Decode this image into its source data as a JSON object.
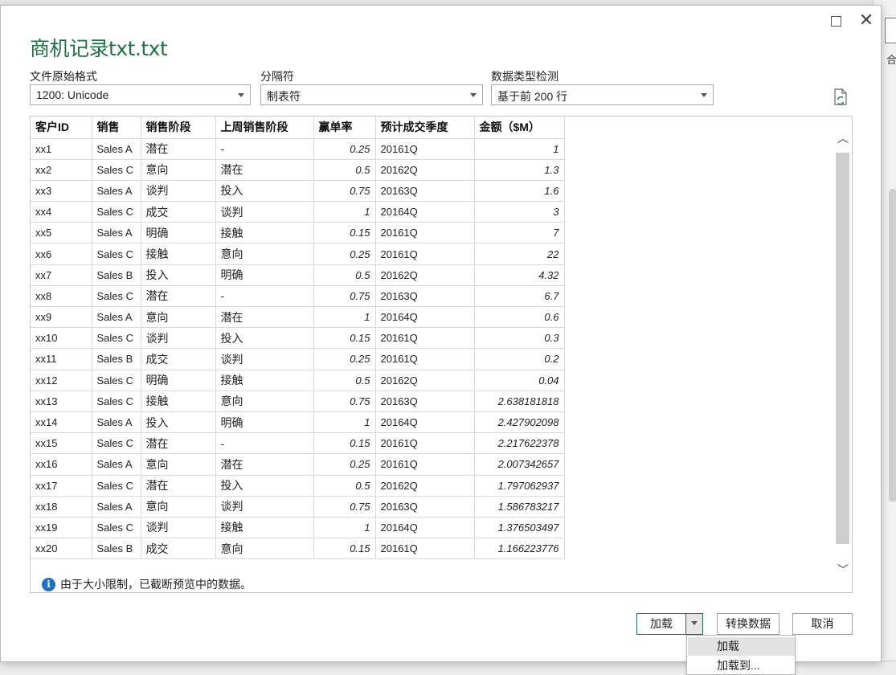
{
  "dialog": {
    "title": "商机记录txt.txt",
    "file_origin": {
      "label": "文件原始格式",
      "value": "1200: Unicode"
    },
    "delimiter": {
      "label": "分隔符",
      "value": "制表符"
    },
    "type_detection": {
      "label": "数据类型检测",
      "value": "基于前 200 行"
    }
  },
  "table": {
    "headers": [
      "客户ID",
      "销售",
      "销售阶段",
      "上周销售阶段",
      "赢单率",
      "预计成交季度",
      "金额（$M）"
    ],
    "rows": [
      [
        "xx1",
        "Sales A",
        "潜在",
        "-",
        "0.25",
        "20161Q",
        "1"
      ],
      [
        "xx2",
        "Sales C",
        "意向",
        "潜在",
        "0.5",
        "20162Q",
        "1.3"
      ],
      [
        "xx3",
        "Sales A",
        "谈判",
        "投入",
        "0.75",
        "20163Q",
        "1.6"
      ],
      [
        "xx4",
        "Sales C",
        "成交",
        "谈判",
        "1",
        "20164Q",
        "3"
      ],
      [
        "xx5",
        "Sales A",
        "明确",
        "接触",
        "0.15",
        "20161Q",
        "7"
      ],
      [
        "xx6",
        "Sales C",
        "接触",
        "意向",
        "0.25",
        "20161Q",
        "22"
      ],
      [
        "xx7",
        "Sales B",
        "投入",
        "明确",
        "0.5",
        "20162Q",
        "4.32"
      ],
      [
        "xx8",
        "Sales C",
        "潜在",
        "-",
        "0.75",
        "20163Q",
        "6.7"
      ],
      [
        "xx9",
        "Sales A",
        "意向",
        "潜在",
        "1",
        "20164Q",
        "0.6"
      ],
      [
        "xx10",
        "Sales C",
        "谈判",
        "投入",
        "0.15",
        "20161Q",
        "0.3"
      ],
      [
        "xx11",
        "Sales B",
        "成交",
        "谈判",
        "0.25",
        "20161Q",
        "0.2"
      ],
      [
        "xx12",
        "Sales C",
        "明确",
        "接触",
        "0.5",
        "20162Q",
        "0.04"
      ],
      [
        "xx13",
        "Sales C",
        "接触",
        "意向",
        "0.75",
        "20163Q",
        "2.638181818"
      ],
      [
        "xx14",
        "Sales A",
        "投入",
        "明确",
        "1",
        "20164Q",
        "2.427902098"
      ],
      [
        "xx15",
        "Sales C",
        "潜在",
        "-",
        "0.15",
        "20161Q",
        "2.217622378"
      ],
      [
        "xx16",
        "Sales A",
        "意向",
        "潜在",
        "0.25",
        "20161Q",
        "2.007342657"
      ],
      [
        "xx17",
        "Sales C",
        "潜在",
        "投入",
        "0.5",
        "20162Q",
        "1.797062937"
      ],
      [
        "xx18",
        "Sales A",
        "意向",
        "谈判",
        "0.75",
        "20163Q",
        "1.586783217"
      ],
      [
        "xx19",
        "Sales C",
        "谈判",
        "接触",
        "1",
        "20164Q",
        "1.376503497"
      ],
      [
        "xx20",
        "Sales B",
        "成交",
        "意向",
        "0.15",
        "20161Q",
        "1.166223776"
      ]
    ]
  },
  "notice": "由于大小限制，已截断预览中的数据。",
  "buttons": {
    "load": "加载",
    "transform": "转换数据",
    "cancel": "取消"
  },
  "load_menu": [
    "加载",
    "加载到..."
  ],
  "background": {
    "right_glyph": "合"
  },
  "colors": {
    "accent": "#217346",
    "info": "#1e6fc5"
  },
  "icons": [
    "maximize-icon",
    "close-icon",
    "refresh-file-icon",
    "info-icon",
    "chevron-up-icon",
    "chevron-down-icon"
  ]
}
